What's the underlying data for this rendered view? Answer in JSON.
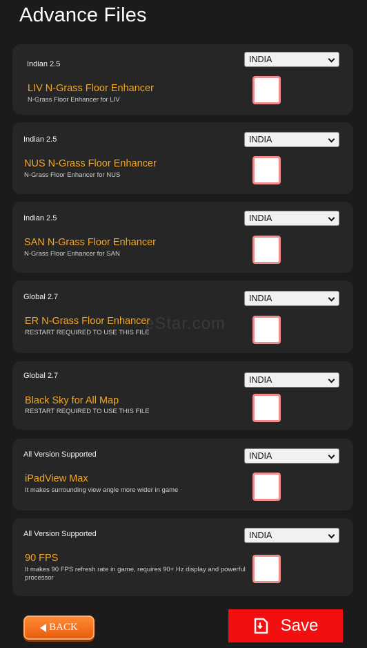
{
  "page": {
    "title": "Advance Files"
  },
  "watermark": "eStar.com",
  "cards": [
    {
      "version": "Indian 2.5",
      "select_value": "INDIA",
      "title": "LIV N-Grass Floor Enhancer",
      "description": "N-Grass Floor Enhancer for LIV",
      "checked": false
    },
    {
      "version": "Indian 2.5",
      "select_value": "INDIA",
      "title": "NUS N-Grass Floor Enhancer",
      "description": "N-Grass Floor Enhancer for NUS",
      "checked": false
    },
    {
      "version": "Indian 2.5",
      "select_value": "INDIA",
      "title": "SAN N-Grass Floor Enhancer",
      "description": "N-Grass Floor Enhancer for SAN",
      "checked": false
    },
    {
      "version": "Global 2.7",
      "select_value": "INDIA",
      "title": "ER N-Grass Floor Enhancer",
      "description": "RESTART REQUIRED TO USE THIS FILE",
      "checked": false
    },
    {
      "version": "Global 2.7",
      "select_value": "INDIA",
      "title": "Black Sky for All Map",
      "description": "RESTART REQUIRED TO USE THIS FILE",
      "checked": false
    },
    {
      "version": "All Version Supported",
      "select_value": "INDIA",
      "title": "iPadView Max",
      "description": "It makes surrounding view angle more wider in game",
      "checked": false
    },
    {
      "version": "All Version Supported",
      "select_value": "INDIA",
      "title": "90 FPS",
      "description": "It makes 90 FPS refresh rate in game, requires 90+ Hz display and powerful processor",
      "checked": false
    }
  ],
  "footer": {
    "back_label": "BACK",
    "back_icon": "triangle-left-icon",
    "save_label": "Save",
    "save_icon": "save-file-icon"
  },
  "colors": {
    "background": "#1b1b1b",
    "card": "#262626",
    "title_accent": "#f5a623",
    "checkbox_border": "#f08c8c",
    "back_button": "#f07020",
    "save_button": "#f20f0f"
  }
}
